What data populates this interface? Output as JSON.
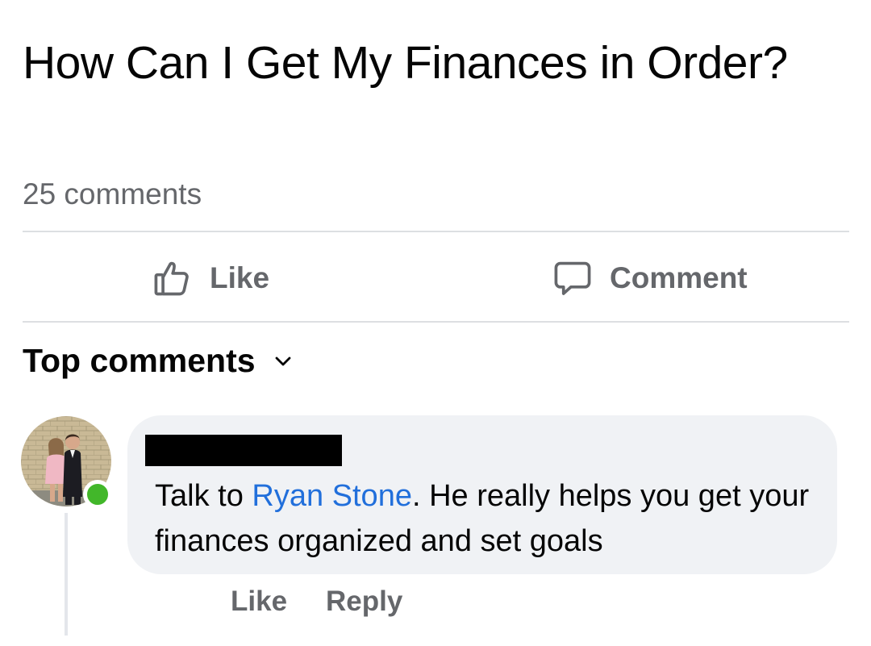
{
  "post": {
    "title": "How Can I Get My Finances in Order?",
    "comment_count": "25 comments"
  },
  "actions": {
    "like_label": "Like",
    "like_icon": "thumbs-up-icon",
    "comment_label": "Comment",
    "comment_icon": "speech-bubble-icon"
  },
  "comments_section": {
    "sort_label": "Top comments",
    "sort_icon": "chevron-down-icon"
  },
  "comment": {
    "author_redacted": true,
    "online_status_color": "#42b72a",
    "text_before": "Talk to ",
    "mention": "Ryan Stone",
    "text_after": ". He really helps you get your finances organized and set goals",
    "like_label": "Like",
    "reply_label": "Reply"
  },
  "colors": {
    "mention": "#216fdb",
    "secondary_text": "#65676b",
    "bubble": "#f0f2f5"
  }
}
